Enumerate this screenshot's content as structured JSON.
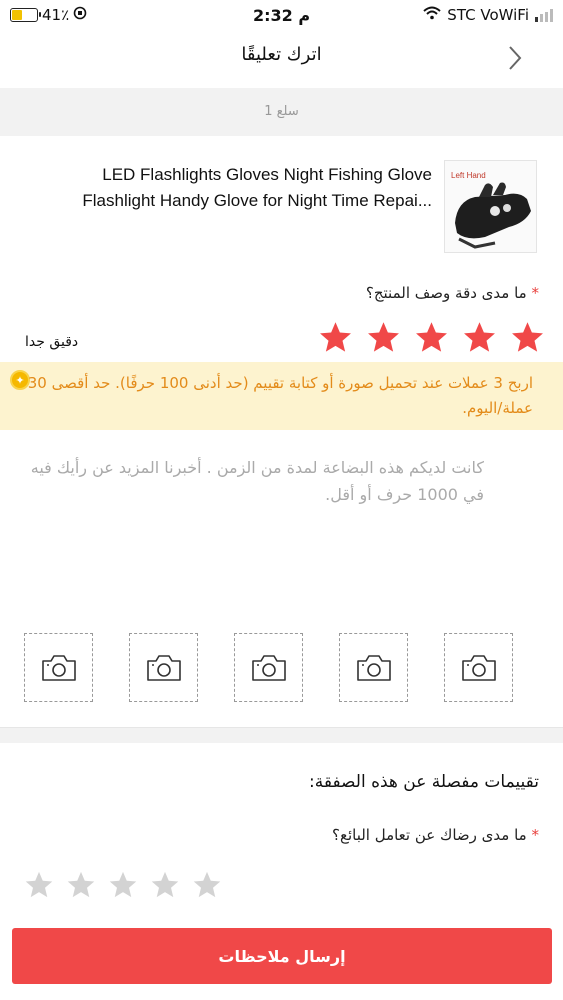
{
  "status_bar": {
    "battery_percent_text": "41٪",
    "battery_level": 0.41,
    "time": "2:32 م",
    "carrier": "STC VoWiFi"
  },
  "header": {
    "title": "اترك تعليقًا"
  },
  "seller_strip": {
    "text": "1 سلع"
  },
  "product": {
    "thumb_label": "Left Hand",
    "title": "LED Flashlights Gloves Night Fishing Glove Flashlight Handy Glove for Night Time Repai..."
  },
  "description_rating": {
    "question": "ما مدى دقة وصف المنتج؟",
    "required_mark": "*",
    "stars_selected": 5,
    "stars_total": 5,
    "selected_label": "دقيق جدا"
  },
  "banner": {
    "text": "اربح 3 عملات عند تحميل صورة أو كتابة تقييم (حد أدنى 100 حرفًا). حد أقصى 30 عملة/اليوم."
  },
  "review": {
    "placeholder": "كانت لديكم هذه البضاعة لمدة من الزمن . أخبرنا المزيد عن رأيك فيه في 1000 حرف أو أقل."
  },
  "photo_slots": 5,
  "detailed": {
    "title": "تقييمات مفصلة عن هذه الصفقة:",
    "seller_question": "ما مدى رضاك عن تعامل البائع؟",
    "required_mark": "*",
    "stars_selected": 0,
    "stars_total": 5
  },
  "submit": {
    "label": "إرسال ملاحظات"
  },
  "colors": {
    "accent": "#f04848",
    "star_active": "#f04848",
    "star_inactive": "#d3d3d3",
    "banner_bg": "#fdf3cf",
    "banner_text": "#e38b1a"
  }
}
